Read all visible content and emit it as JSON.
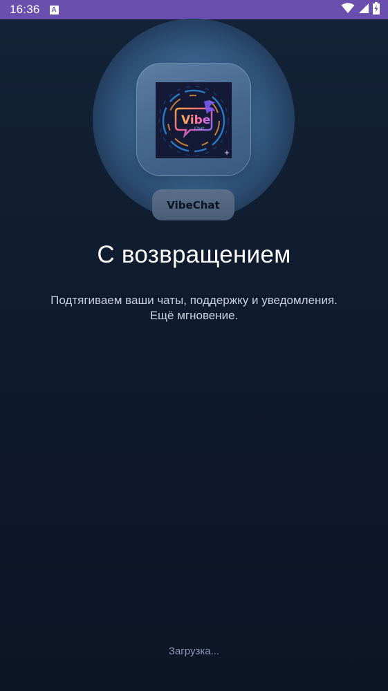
{
  "status_bar": {
    "time": "16:36",
    "notification_icon": "A",
    "icons": [
      "wifi-icon",
      "signal-icon",
      "battery-icon"
    ]
  },
  "logo": {
    "word": "Vibe",
    "subword": "Chat"
  },
  "app_name": "VibeChat",
  "title": "С возвращением",
  "subtitle": {
    "line1": "Подтягиваем ваши чаты, поддержку и уведомления.",
    "line2": "Ещё мгновение."
  },
  "loading_text": "Загрузка...",
  "colors": {
    "status_bar": "#6a4fae",
    "background": "#101b2e",
    "accent_glow": "#4e82c4"
  }
}
